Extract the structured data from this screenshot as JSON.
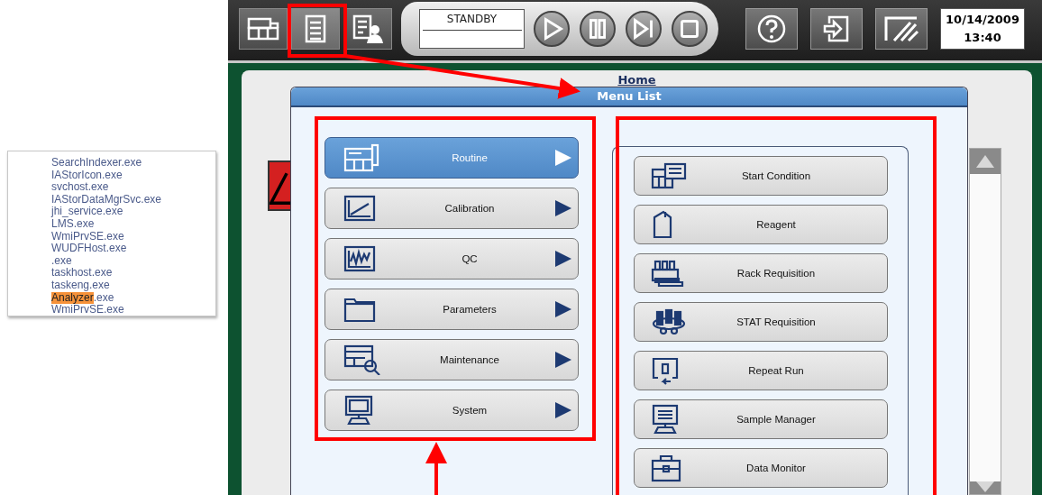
{
  "process_list": {
    "items": [
      {
        "text": "SearchIndexer.exe"
      },
      {
        "text": "IAStorIcon.exe"
      },
      {
        "text": "svchost.exe"
      },
      {
        "text": "IAStorDataMgrSvc.exe"
      },
      {
        "text": "jhi_service.exe"
      },
      {
        "text": "LMS.exe"
      },
      {
        "text": "WmiPrvSE.exe"
      },
      {
        "text": "WUDFHost.exe"
      },
      {
        "text": ".exe"
      },
      {
        "text": "taskhost.exe"
      },
      {
        "text": "taskeng.exe"
      },
      {
        "highlight": "Analyzer",
        "text": ".exe"
      },
      {
        "text": "WmiPrvSE.exe"
      }
    ]
  },
  "toolbar": {
    "view_buttons": [
      {
        "selected": false
      },
      {
        "selected": true
      },
      {
        "selected": false
      }
    ],
    "status": "STANDBY",
    "date": "10/14/2009",
    "time": "13:40"
  },
  "home": {
    "title": "Home"
  },
  "menu_dialog": {
    "title": "Menu List",
    "categories": [
      {
        "label": "Routine",
        "selected": true
      },
      {
        "label": "Calibration",
        "selected": false
      },
      {
        "label": "QC",
        "selected": false
      },
      {
        "label": "Parameters",
        "selected": false
      },
      {
        "label": "Maintenance",
        "selected": false
      },
      {
        "label": "System",
        "selected": false
      }
    ],
    "functions": [
      {
        "label": "Start Condition"
      },
      {
        "label": "Reagent"
      },
      {
        "label": "Rack Requisition"
      },
      {
        "label": "STAT Requisition"
      },
      {
        "label": "Repeat Run"
      },
      {
        "label": "Sample Manager"
      },
      {
        "label": "Data Monitor"
      }
    ]
  }
}
